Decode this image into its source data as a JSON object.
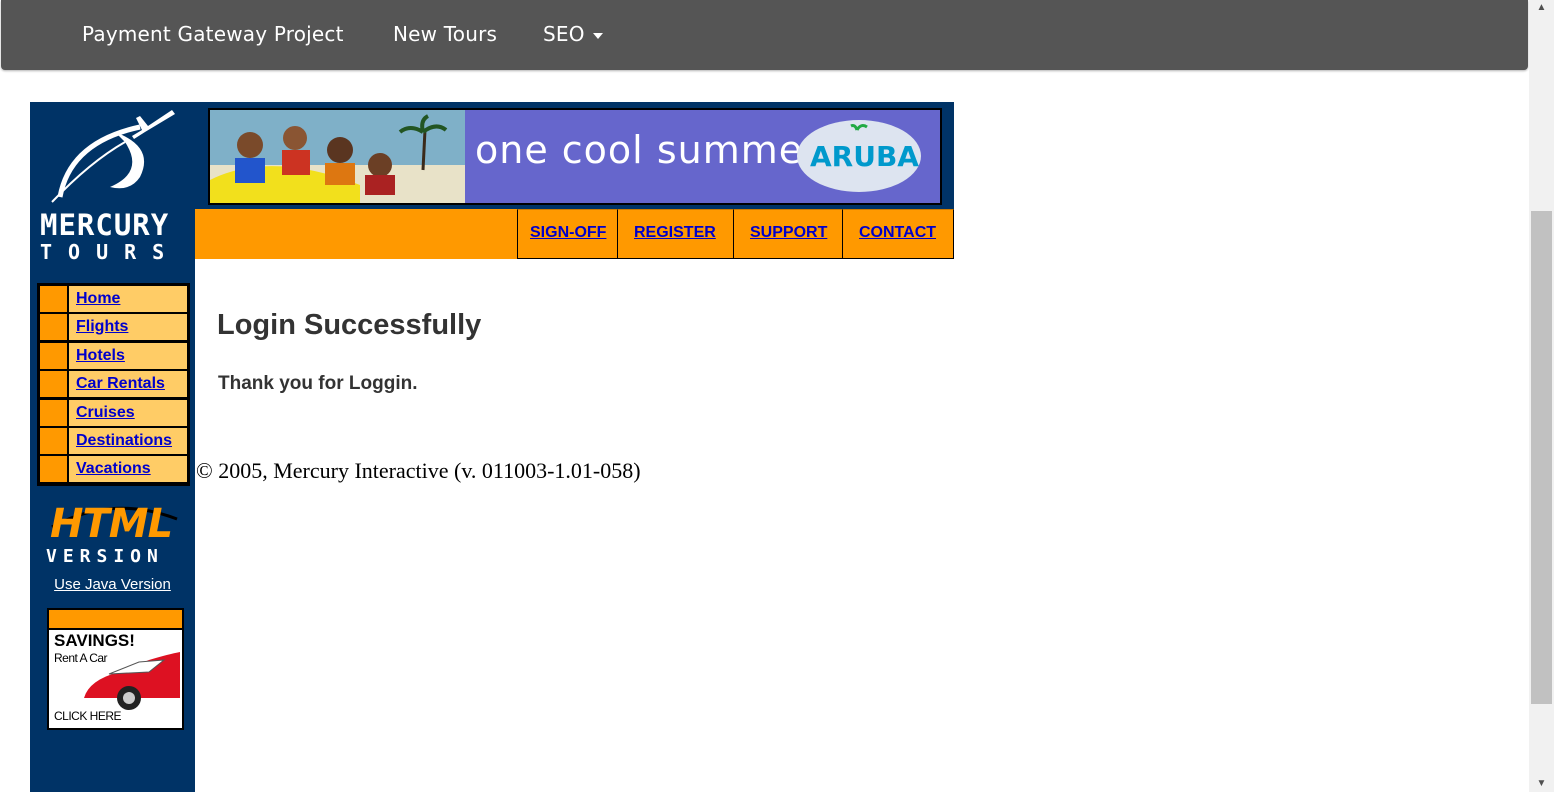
{
  "topnav": {
    "items": [
      {
        "label": "Payment Gateway Project"
      },
      {
        "label": "New Tours"
      },
      {
        "label": "SEO"
      }
    ],
    "bg_color": "#555555"
  },
  "sidebar": {
    "logo_line1": "MERCURY",
    "logo_line2": "TOURS",
    "menu": [
      {
        "label": "Home"
      },
      {
        "label": "Flights"
      },
      {
        "label": "Hotels"
      },
      {
        "label": "Car Rentals"
      },
      {
        "label": "Cruises"
      },
      {
        "label": "Destinations"
      },
      {
        "label": "Vacations"
      }
    ],
    "html_version_line1": "HTML",
    "html_version_line2": "VERSION",
    "java_link": "Use Java Version",
    "ad": {
      "line1": "SAVINGS!",
      "line2": "Rent A Car",
      "line3": "CLICK HERE"
    },
    "bg_color": "#003366"
  },
  "banner": {
    "text": "one cool summer",
    "brand": "ARUBA"
  },
  "top_links": [
    {
      "label": "SIGN-OFF"
    },
    {
      "label": "REGISTER"
    },
    {
      "label": "SUPPORT"
    },
    {
      "label": "CONTACT"
    }
  ],
  "main": {
    "title": "Login Successfully",
    "message": "Thank you for Loggin.",
    "copyright": "© 2005, Mercury Interactive (v. 011003-1.01-058)"
  },
  "colors": {
    "orange": "#FF9900",
    "light_orange": "#FFCC66",
    "link_blue": "#0000CC",
    "banner_purple": "#6666CC"
  }
}
